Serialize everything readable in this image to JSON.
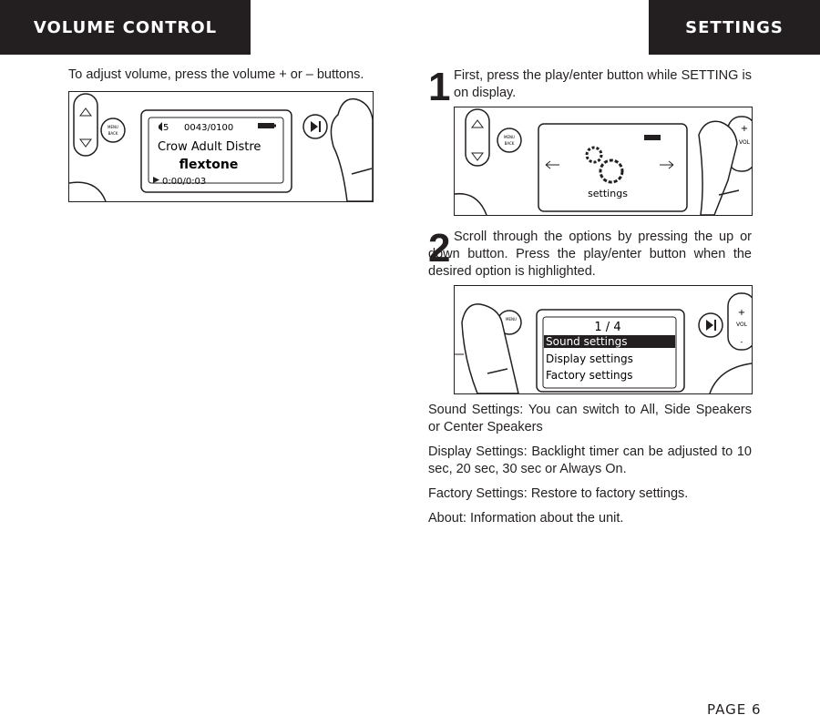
{
  "header": {
    "left_title": "VOLUME CONTROL",
    "right_title": "SETTINGS"
  },
  "volume": {
    "instruction": "To adjust volume, press the volume + or – buttons.",
    "screen": {
      "volume": "5",
      "track": "0043/0100",
      "title": "Crow Adult Distre",
      "artist": "flextone",
      "time": "0:00/0:03"
    },
    "buttons": {
      "menu": "MENU",
      "back": "BACK"
    }
  },
  "settings": {
    "step1": {
      "number": "1",
      "text": "First, press the play/enter button while SETTING is on display.",
      "screen_label": "settings"
    },
    "step2": {
      "number": "2",
      "text": "Scroll through the options by pressing the up or down button. Press the play/enter button when the desired option is highlighted.",
      "screen": {
        "page": "1 / 4",
        "items": [
          "Sound settings",
          "Display settings",
          "Factory settings"
        ],
        "selected_index": 0
      }
    },
    "vol_label": "VOL",
    "plus": "+",
    "minus": "-",
    "descriptions": [
      "Sound Settings: You can switch to All, Side Speakers or Center Speakers",
      "Display Settings: Backlight timer can be adjusted to 10 sec, 20 sec, 30 sec or Always On.",
      "Factory Settings: Restore to factory settings.",
      "About: Information about the unit."
    ]
  },
  "footer": {
    "page": "PAGE 6"
  }
}
